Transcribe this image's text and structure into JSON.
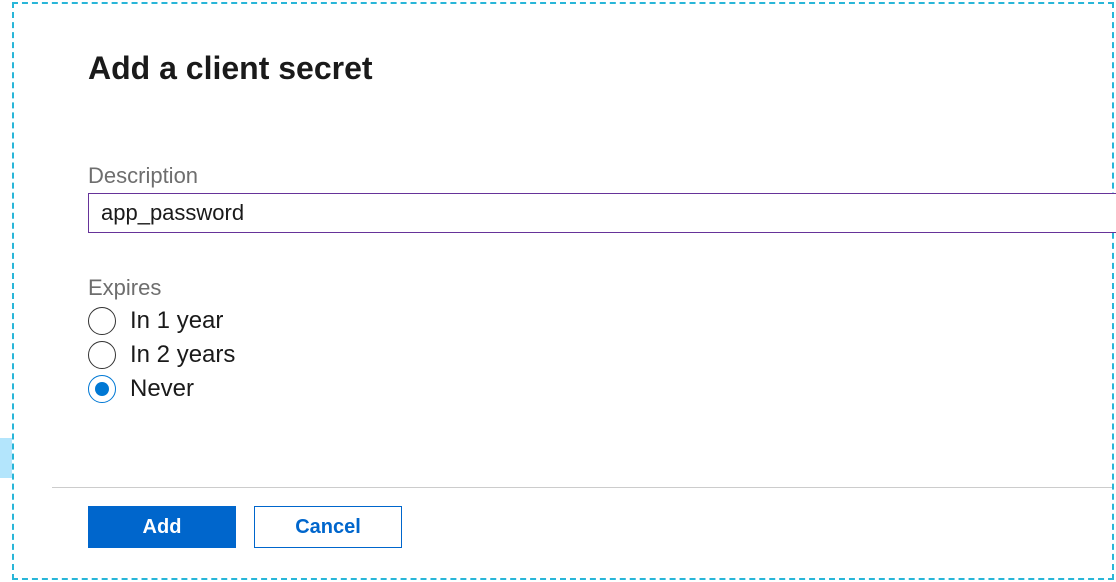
{
  "panel": {
    "title": "Add a client secret"
  },
  "form": {
    "description": {
      "label": "Description",
      "value": "app_password"
    },
    "expires": {
      "label": "Expires",
      "options": [
        {
          "label": "In 1 year",
          "selected": false
        },
        {
          "label": "In 2 years",
          "selected": false
        },
        {
          "label": "Never",
          "selected": true
        }
      ]
    }
  },
  "buttons": {
    "add": "Add",
    "cancel": "Cancel"
  },
  "colors": {
    "primary": "#0066cc",
    "inputBorder": "#663399",
    "dashedBorder": "#29b6d8"
  }
}
